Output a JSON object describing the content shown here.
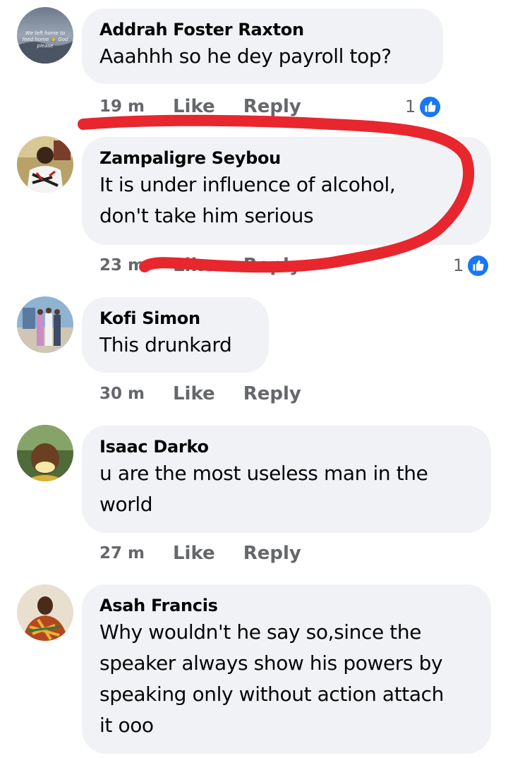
{
  "comments": [
    {
      "author": "Addrah Foster Raxton",
      "text": "Aaahhh so he dey payroll top?",
      "time": "19 m",
      "like_label": "Like",
      "reply_label": "Reply",
      "reaction_count": "1",
      "avatar_text": [
        "We left home to",
        "feed home 🙏 God",
        "please"
      ]
    },
    {
      "author": "Zampaligre Seybou",
      "text_lines": [
        "It is under influence of alcohol,",
        "don't take him serious"
      ],
      "time": "23 m",
      "like_label": "Like",
      "reply_label": "Reply",
      "reaction_count": "1"
    },
    {
      "author": "Kofi Simon",
      "text": "This drunkard",
      "time": "30 m",
      "like_label": "Like",
      "reply_label": "Reply"
    },
    {
      "author": "Isaac Darko",
      "text_lines": [
        "u are the most useless man in the",
        "world"
      ],
      "time": "27 m",
      "like_label": "Like",
      "reply_label": "Reply"
    },
    {
      "author": "Asah Francis",
      "text_lines": [
        "Why wouldn't he say so,since the",
        "speaker always show his powers by",
        "speaking only without action attach",
        "it ooo"
      ]
    }
  ],
  "colors": {
    "bubble": "#f0f2f5",
    "meta_text": "#65676b",
    "like_badge": "#1877f2",
    "annotation": "#e8262d"
  },
  "icons": {
    "reaction": "thumbs-up-icon"
  }
}
